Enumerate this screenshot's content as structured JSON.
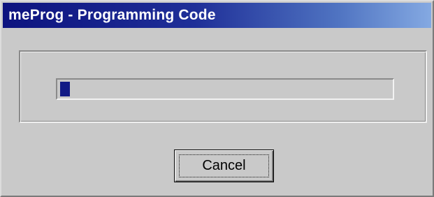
{
  "window": {
    "title": "meProg - Programming Code"
  },
  "progress": {
    "fraction": 0.03,
    "fill_color": "#111a85"
  },
  "buttons": {
    "cancel_label": "Cancel"
  },
  "colors": {
    "title_gradient_start": "#0d137f",
    "title_gradient_end": "#84a9e2",
    "face": "#c9c9c9"
  }
}
